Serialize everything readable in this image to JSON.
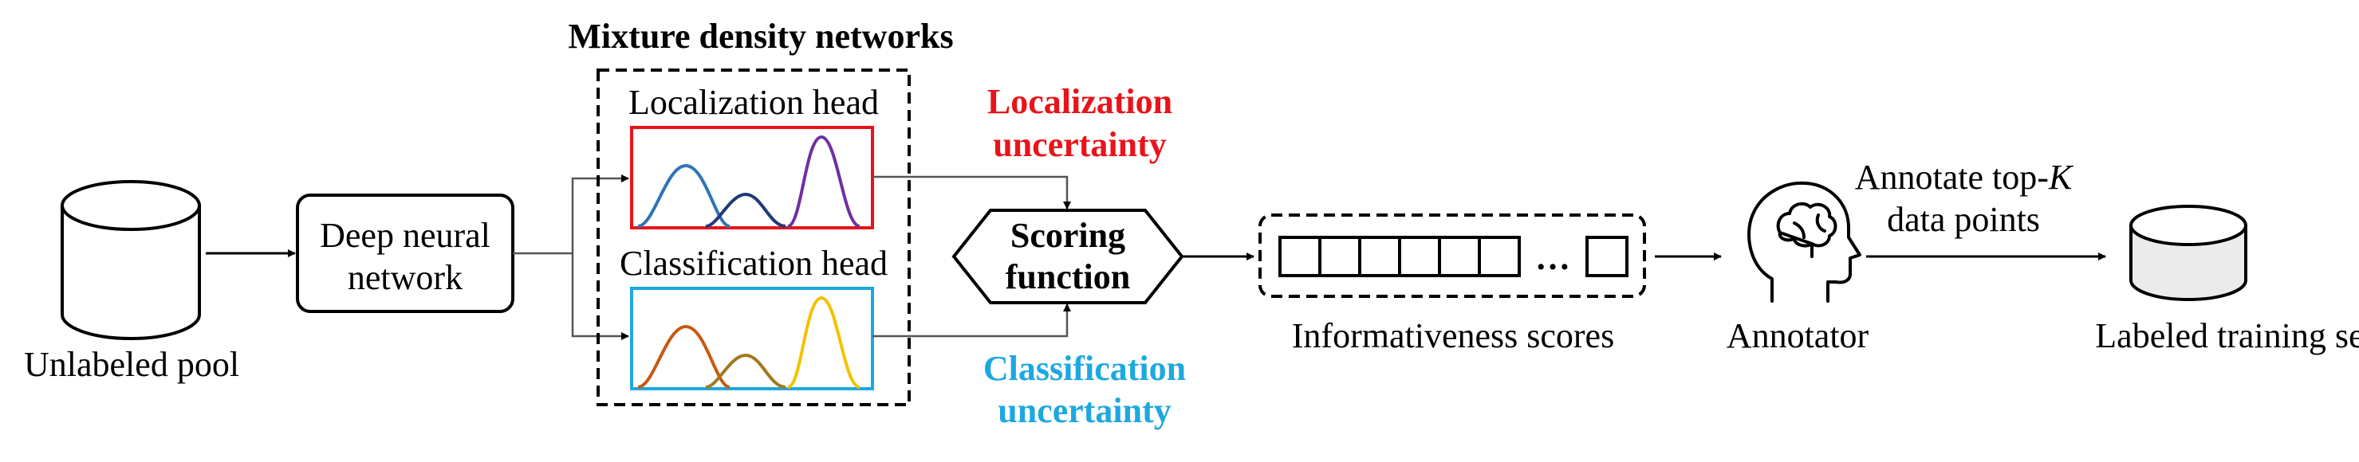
{
  "nodes": {
    "unlabeled_pool": "Unlabeled pool",
    "dnn_line1": "Deep neural",
    "dnn_line2": "network",
    "mdn_title": "Mixture density networks",
    "loc_head": "Localization head",
    "cls_head": "Classification head",
    "scoring_line1": "Scoring",
    "scoring_line2": "function",
    "informativeness": "Informativeness scores",
    "ellipsis": "…",
    "annotator": "Annotator",
    "annotate_line1_prefix": "Annotate top-",
    "annotate_line1_var": "K",
    "annotate_line2": "data points",
    "labeled_set": "Labeled training set"
  },
  "uncertainty": {
    "loc_line1": "Localization",
    "loc_line2": "uncertainty",
    "cls_line1": "Classification",
    "cls_line2": "uncertainty"
  },
  "colors": {
    "loc_red": "#e8141a",
    "cls_blue": "#1ea8e0",
    "gauss_loc": [
      "#2e75b6",
      "#1f3a7a",
      "#7030a0"
    ],
    "gauss_cls": [
      "#c55a11",
      "#a3781e",
      "#f2c200"
    ],
    "db_fill_labeled": "#ebebeb"
  },
  "icons": [
    "database-icon",
    "head-brain-icon",
    "database-icon"
  ]
}
